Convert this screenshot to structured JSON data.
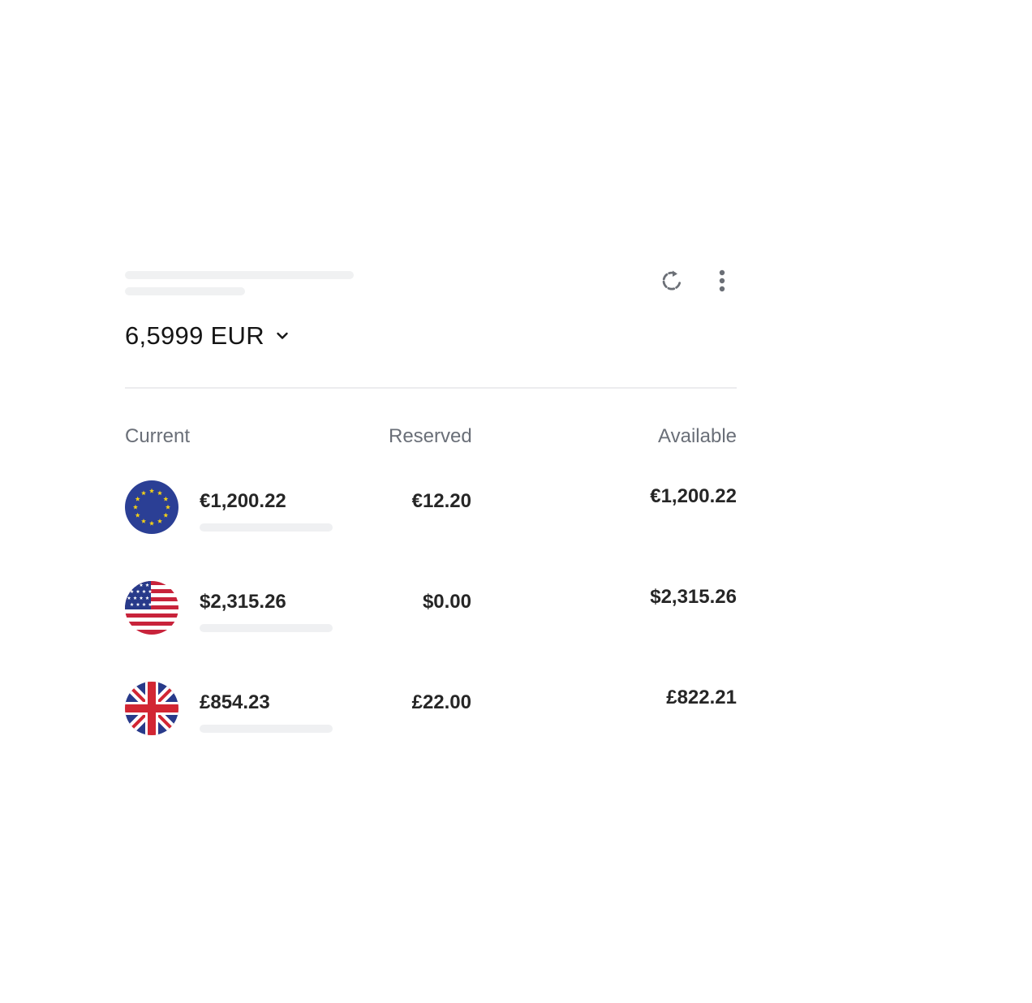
{
  "header": {
    "rate_value": "6,5999 EUR",
    "refresh_icon": "refresh-icon",
    "more_icon": "more-vertical-icon",
    "chevron_icon": "chevron-down-icon"
  },
  "columns": {
    "current": "Current",
    "reserved": "Reserved",
    "available": "Available"
  },
  "rows": [
    {
      "flag": "eu-flag-icon",
      "current": "€1,200.22",
      "reserved": "€12.20",
      "available": "€1,200.22"
    },
    {
      "flag": "us-flag-icon",
      "current": "$2,315.26",
      "reserved": "$0.00",
      "available": "$2,315.26"
    },
    {
      "flag": "uk-flag-icon",
      "current": "£854.23",
      "reserved": "£22.00",
      "available": "£822.21"
    }
  ],
  "colors": {
    "text_primary": "#1f1f1f",
    "text_muted": "#6a6f78",
    "icon": "#6b6f76",
    "skeleton": "#f0f1f2",
    "eu_blue": "#2b3f95",
    "eu_star": "#f5d116",
    "us_red": "#c8233b",
    "us_blue": "#283a8a",
    "uk_red": "#d22633",
    "uk_blue": "#283a8a"
  }
}
